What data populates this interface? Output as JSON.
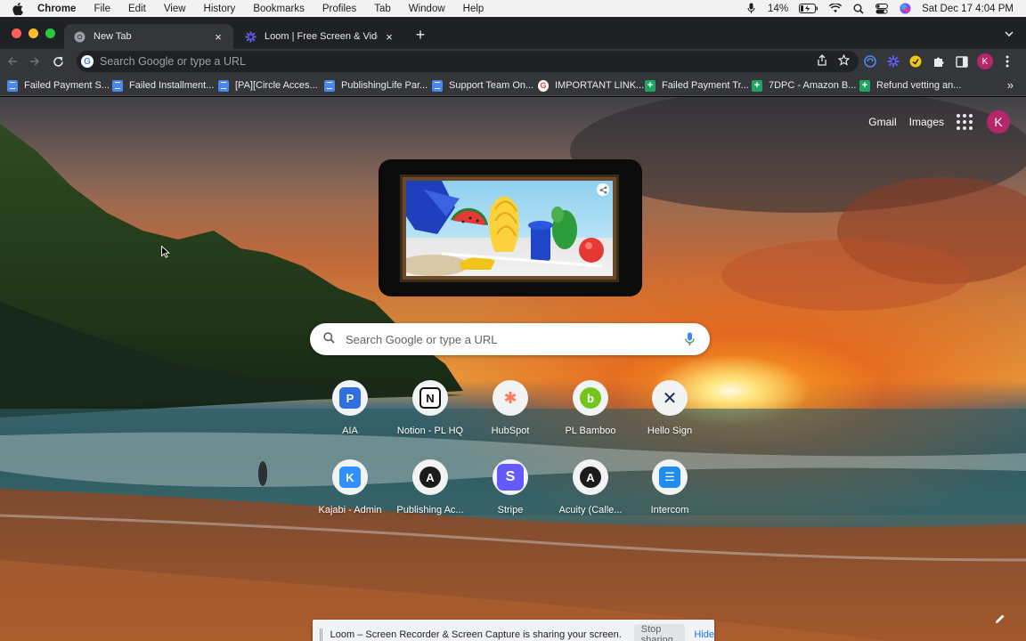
{
  "menubar": {
    "app": "Chrome",
    "items": [
      "File",
      "Edit",
      "View",
      "History",
      "Bookmarks",
      "Profiles",
      "Tab",
      "Window",
      "Help"
    ],
    "battery": "14%",
    "datetime": "Sat Dec 17  4:04 PM"
  },
  "tabs": [
    {
      "title": "New Tab",
      "active": true
    },
    {
      "title": "Loom | Free Screen & Video Re",
      "active": false
    }
  ],
  "omnibox": {
    "placeholder": "Search Google or type a URL"
  },
  "bookmarks": [
    {
      "label": "Failed Payment S...",
      "icon": "doc"
    },
    {
      "label": "Failed Installment...",
      "icon": "doc"
    },
    {
      "label": "[PA][Circle Acces...",
      "icon": "doc"
    },
    {
      "label": "PublishingLife Par...",
      "icon": "doc"
    },
    {
      "label": "Support Team On...",
      "icon": "doc"
    },
    {
      "label": "IMPORTANT LINK...",
      "icon": "google"
    },
    {
      "label": "Failed Payment Tr...",
      "icon": "sheet"
    },
    {
      "label": "7DPC - Amazon B...",
      "icon": "sheet"
    },
    {
      "label": "Refund vetting an...",
      "icon": "sheet"
    }
  ],
  "ntp": {
    "gmail": "Gmail",
    "images": "Images",
    "avatar_letter": "K",
    "search_placeholder": "Search Google or type a URL",
    "shortcuts": [
      {
        "label": "AIA",
        "color": "#2f6fe0",
        "glyph": "P"
      },
      {
        "label": "Notion - PL HQ",
        "color": "#ffffff",
        "glyph": "N"
      },
      {
        "label": "HubSpot",
        "color": "#ff7a59",
        "glyph": "✱"
      },
      {
        "label": "PL Bamboo",
        "color": "#73c41d",
        "glyph": "b"
      },
      {
        "label": "Hello Sign",
        "color": "#1d2a57",
        "glyph": "✕"
      },
      {
        "label": "Kajabi - Admin",
        "color": "#2e91fc",
        "glyph": "K"
      },
      {
        "label": "Publishing Ac...",
        "color": "#1b1b1b",
        "glyph": "A"
      },
      {
        "label": "Stripe",
        "color": "#635bff",
        "glyph": "S"
      },
      {
        "label": "Acuity (Calle...",
        "color": "#1b1b1b",
        "glyph": "A"
      },
      {
        "label": "Intercom",
        "color": "#1f8ded",
        "glyph": "☰"
      }
    ]
  },
  "sharebar": {
    "text": "Loom – Screen Recorder & Screen Capture is sharing your screen.",
    "stop": "Stop sharing",
    "hide": "Hide"
  }
}
